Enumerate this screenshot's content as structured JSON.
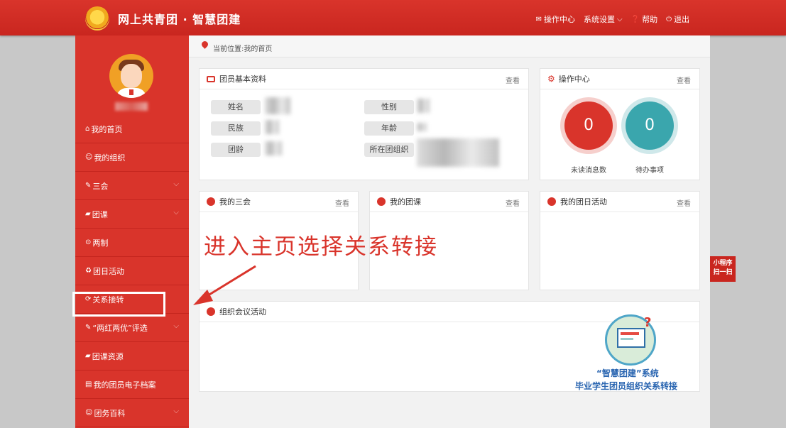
{
  "header": {
    "title": "网上共青团 · 智慧团建",
    "nav": [
      {
        "icon": "envelope-icon",
        "label": "操作中心"
      },
      {
        "icon": "",
        "label": "系统设置"
      },
      {
        "icon": "help-icon",
        "label": "帮助"
      },
      {
        "icon": "power-icon",
        "label": "退出"
      }
    ]
  },
  "sidebar": {
    "items": [
      {
        "label": "我的首页",
        "icon": "home-icon"
      },
      {
        "label": "我的组织",
        "icon": "users-icon"
      },
      {
        "label": "三会",
        "icon": "edit-icon"
      },
      {
        "label": "团课",
        "icon": "folder-icon"
      },
      {
        "label": "两制",
        "icon": "circle-icon"
      },
      {
        "label": "团日活动",
        "icon": "recycle-icon"
      },
      {
        "label": "关系接转",
        "icon": "refresh-icon"
      },
      {
        "label": "“两红两优”评选",
        "icon": "edit-icon"
      },
      {
        "label": "团课资源",
        "icon": "folder-icon"
      },
      {
        "label": "我的团员电子档案",
        "icon": "file-icon"
      },
      {
        "label": "团务百科",
        "icon": "users-icon"
      }
    ]
  },
  "breadcrumb": "当前位置:我的首页",
  "profile_panel": {
    "title": "团员基本资料",
    "more": "查看",
    "fields": {
      "name": "姓名",
      "gender": "性别",
      "ethnicity": "民族",
      "age": "年龄",
      "league_age": "团龄",
      "org": "所在团组织"
    }
  },
  "ops_panel": {
    "title": "操作中心",
    "more": "查看",
    "unread_count": "0",
    "unread_label": "未读消息数",
    "todo_count": "0",
    "todo_label": "待办事项"
  },
  "meetings_panel": {
    "title": "我的三会",
    "more": "查看"
  },
  "course_panel": {
    "title": "我的团课",
    "more": "查看"
  },
  "activity_panel": {
    "title": "我的团日活动",
    "more": "查看"
  },
  "org_meeting_panel": {
    "title": "组织会议活动"
  },
  "annotation": "进入主页选择关系转接",
  "promo": {
    "line1": "“智慧团建”系统",
    "line2": "毕业学生团员组织关系转接"
  },
  "mini_program": {
    "line1": "小程序",
    "line2": "扫一扫"
  },
  "colors": {
    "brand_red": "#d9342b",
    "teal": "#3aa6ad"
  }
}
